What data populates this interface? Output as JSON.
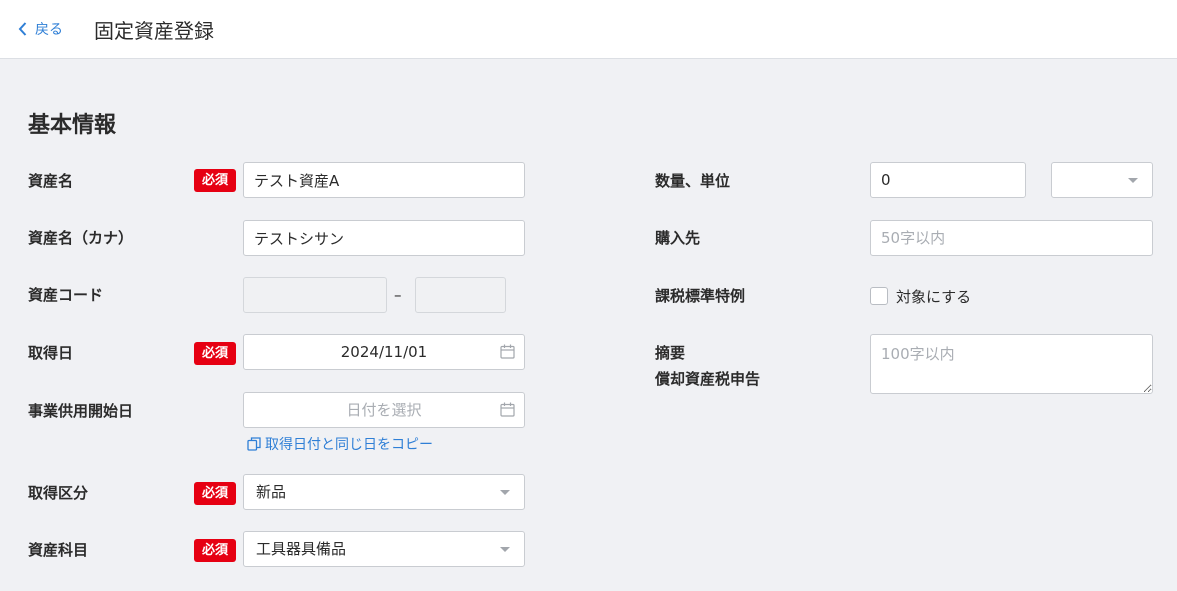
{
  "header": {
    "back_label": "戻る",
    "title": "固定資産登録"
  },
  "section_title": "基本情報",
  "required_badge": "必須",
  "fields": {
    "asset_name": {
      "label": "資産名",
      "value": "テスト資産A"
    },
    "asset_name_kana": {
      "label": "資産名（カナ）",
      "value": "テストシサン"
    },
    "asset_code": {
      "label": "資産コード",
      "value1": "",
      "value2": "",
      "separator": "–"
    },
    "acquisition_date": {
      "label": "取得日",
      "value": "2024/11/01"
    },
    "service_start_date": {
      "label": "事業供用開始日",
      "placeholder": "日付を選択",
      "copy_link": "取得日付と同じ日をコピー"
    },
    "acquisition_type": {
      "label": "取得区分",
      "value": "新品"
    },
    "asset_account": {
      "label": "資産科目",
      "value": "工具器具備品"
    },
    "quantity_unit": {
      "label": "数量、単位",
      "quantity": "0",
      "unit": ""
    },
    "supplier": {
      "label": "購入先",
      "placeholder": "50字以内"
    },
    "tax_special": {
      "label": "課税標準特例",
      "checkbox_label": "対象にする",
      "checked": false
    },
    "summary": {
      "label_line1": "摘要",
      "label_line2": "償却資産税申告",
      "placeholder": "100字以内"
    }
  },
  "colors": {
    "accent": "#2f7fd6",
    "required": "#e60012",
    "background": "#f0f1f4"
  }
}
